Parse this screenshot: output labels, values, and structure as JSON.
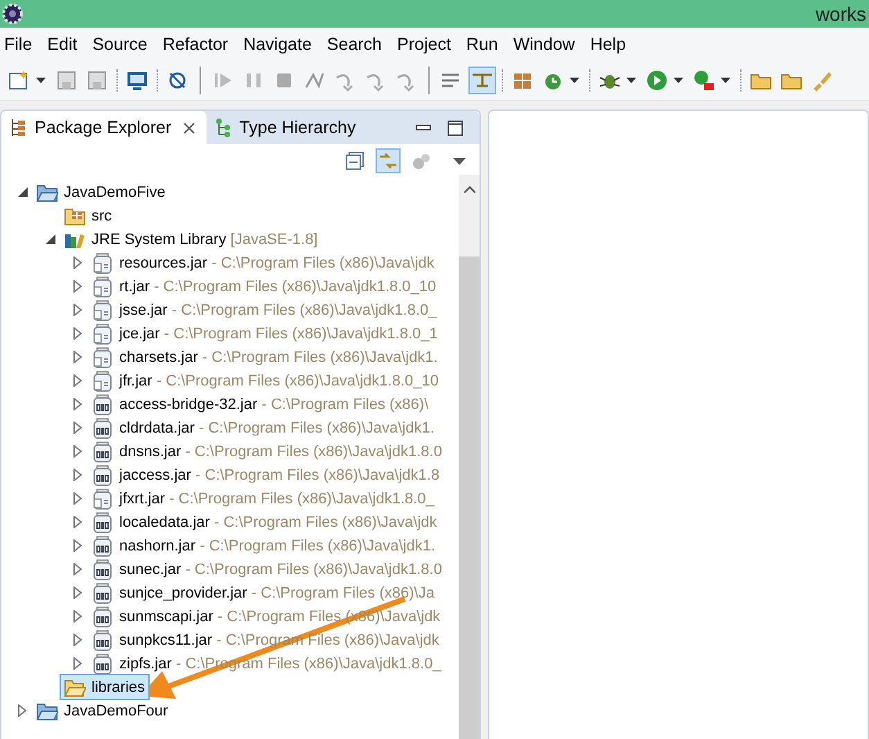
{
  "window": {
    "title": "works"
  },
  "menu": [
    "File",
    "Edit",
    "Source",
    "Refactor",
    "Navigate",
    "Search",
    "Project",
    "Run",
    "Window",
    "Help"
  ],
  "tabs": [
    {
      "label": "Package Explorer",
      "selected": true
    },
    {
      "label": "Type Hierarchy",
      "selected": false
    }
  ],
  "tree": [
    {
      "label": "JavaDemoFive",
      "kind": "project",
      "expanded": true,
      "selected": false,
      "children": [
        {
          "label": "src",
          "kind": "source-folder",
          "selected": false
        },
        {
          "label": "JRE System Library",
          "detail": "[JavaSE-1.8]",
          "kind": "library",
          "expanded": true,
          "selected": false,
          "children": [
            {
              "label": "resources.jar",
              "detail": "- C:\\Program Files (x86)\\Java\\jdk",
              "kind": "jar-doc",
              "expanded": false,
              "selected": false
            },
            {
              "label": "rt.jar",
              "detail": "- C:\\Program Files (x86)\\Java\\jdk1.8.0_10",
              "kind": "jar-doc",
              "expanded": false,
              "selected": false
            },
            {
              "label": "jsse.jar",
              "detail": "- C:\\Program Files (x86)\\Java\\jdk1.8.0_",
              "kind": "jar-doc",
              "expanded": false,
              "selected": false
            },
            {
              "label": "jce.jar",
              "detail": "- C:\\Program Files (x86)\\Java\\jdk1.8.0_1",
              "kind": "jar-doc",
              "expanded": false,
              "selected": false
            },
            {
              "label": "charsets.jar",
              "detail": "- C:\\Program Files (x86)\\Java\\jdk1.",
              "kind": "jar-doc",
              "expanded": false,
              "selected": false
            },
            {
              "label": "jfr.jar",
              "detail": "- C:\\Program Files (x86)\\Java\\jdk1.8.0_10",
              "kind": "jar-doc",
              "expanded": false,
              "selected": false
            },
            {
              "label": "access-bridge-32.jar",
              "detail": "- C:\\Program Files (x86)\\",
              "kind": "jar",
              "expanded": false,
              "selected": false
            },
            {
              "label": "cldrdata.jar",
              "detail": "- C:\\Program Files (x86)\\Java\\jdk1.",
              "kind": "jar",
              "expanded": false,
              "selected": false
            },
            {
              "label": "dnsns.jar",
              "detail": "- C:\\Program Files (x86)\\Java\\jdk1.8.0",
              "kind": "jar",
              "expanded": false,
              "selected": false
            },
            {
              "label": "jaccess.jar",
              "detail": "- C:\\Program Files (x86)\\Java\\jdk1.8",
              "kind": "jar",
              "expanded": false,
              "selected": false
            },
            {
              "label": "jfxrt.jar",
              "detail": "- C:\\Program Files (x86)\\Java\\jdk1.8.0_",
              "kind": "jar-doc",
              "expanded": false,
              "selected": false
            },
            {
              "label": "localedata.jar",
              "detail": "- C:\\Program Files (x86)\\Java\\jdk",
              "kind": "jar",
              "expanded": false,
              "selected": false
            },
            {
              "label": "nashorn.jar",
              "detail": "- C:\\Program Files (x86)\\Java\\jdk1.",
              "kind": "jar",
              "expanded": false,
              "selected": false
            },
            {
              "label": "sunec.jar",
              "detail": "- C:\\Program Files (x86)\\Java\\jdk1.8.0",
              "kind": "jar",
              "expanded": false,
              "selected": false
            },
            {
              "label": "sunjce_provider.jar",
              "detail": "- C:\\Program Files (x86)\\Ja",
              "kind": "jar",
              "expanded": false,
              "selected": false
            },
            {
              "label": "sunmscapi.jar",
              "detail": "- C:\\Program Files (x86)\\Java\\jdk",
              "kind": "jar",
              "expanded": false,
              "selected": false
            },
            {
              "label": "sunpkcs11.jar",
              "detail": "- C:\\Program Files (x86)\\Java\\jdk",
              "kind": "jar",
              "expanded": false,
              "selected": false
            },
            {
              "label": "zipfs.jar",
              "detail": "- C:\\Program Files (x86)\\Java\\jdk1.8.0_",
              "kind": "jar",
              "expanded": false,
              "selected": false
            }
          ]
        },
        {
          "label": "libraries",
          "kind": "folder",
          "selected": true
        }
      ]
    },
    {
      "label": "JavaDemoFour",
      "kind": "project",
      "expanded": false,
      "selected": false
    }
  ]
}
